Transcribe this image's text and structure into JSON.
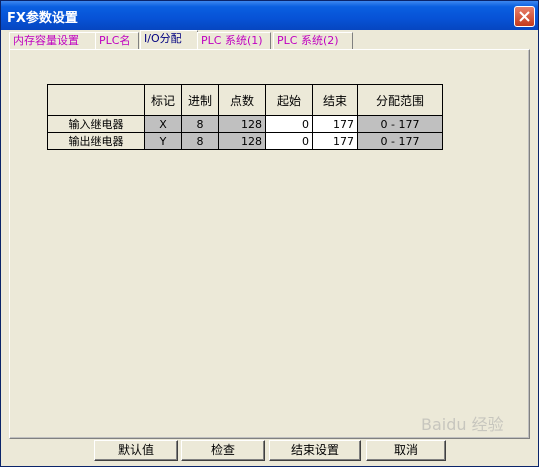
{
  "window": {
    "title": "FX参数设置"
  },
  "tabs": [
    {
      "label": "内存容量设置"
    },
    {
      "label": "PLC名"
    },
    {
      "label": "I/O分配"
    },
    {
      "label": "PLC 系统(1)"
    },
    {
      "label": "PLC 系统(2)"
    }
  ],
  "table": {
    "headers": [
      "",
      "标记",
      "进制",
      "点数",
      "起始",
      "结束",
      "分配范围"
    ],
    "rows": [
      {
        "name": "输入继电器",
        "mark": "X",
        "base": "8",
        "points": "128",
        "start": "0",
        "end": "177",
        "range": "0 - 177"
      },
      {
        "name": "输出继电器",
        "mark": "Y",
        "base": "8",
        "points": "128",
        "start": "0",
        "end": "177",
        "range": "0 - 177"
      }
    ]
  },
  "buttons": {
    "default": "默认值",
    "check": "检查",
    "finish": "结束设置",
    "cancel": "取消"
  },
  "watermark": "Baidu 经验"
}
